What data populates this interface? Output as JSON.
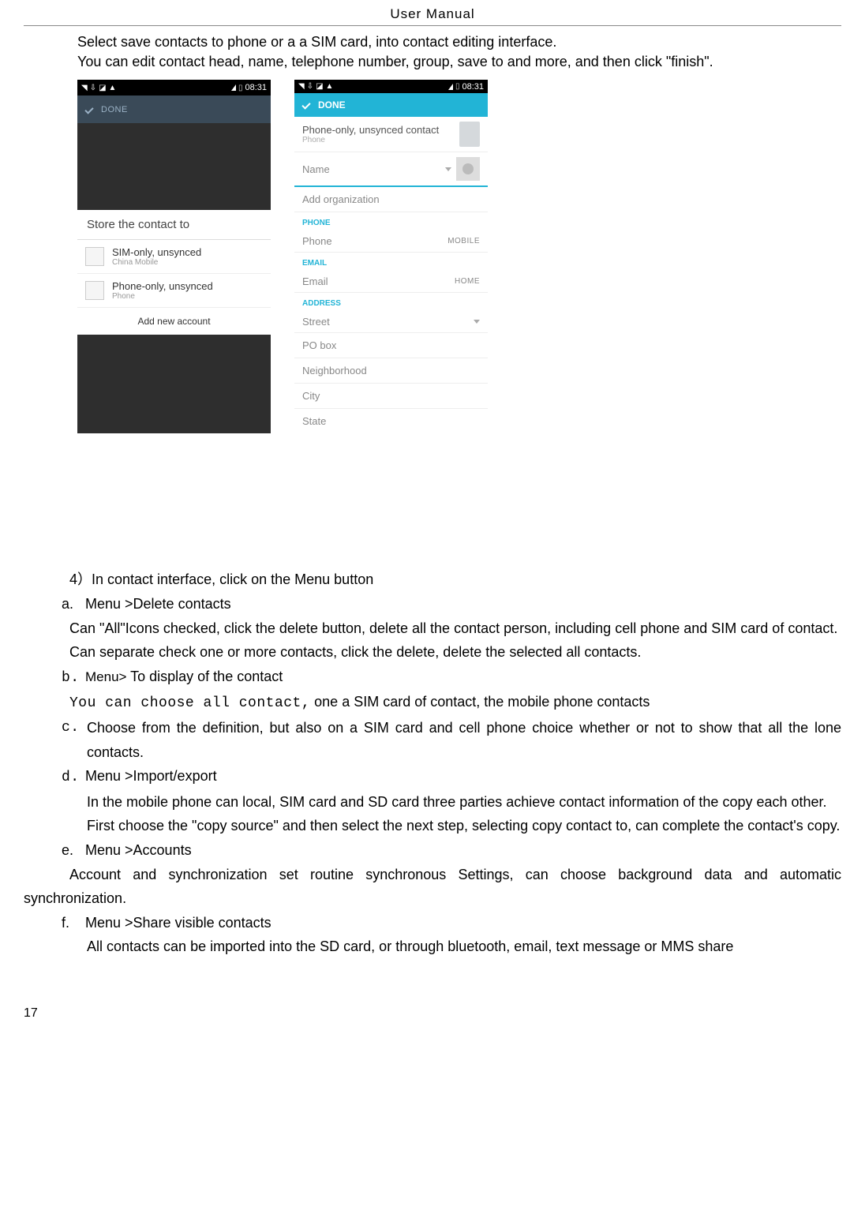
{
  "header": "User    Manual",
  "intro": {
    "line1": "Select save contacts to phone or a a SIM card, into contact editing interface.",
    "line2": "You can edit contact head, name, telephone number, group, save to and more, and then click \"finish\"."
  },
  "statusbar": {
    "time": "08:31"
  },
  "left_phone": {
    "done": "DONE",
    "dialog_title": "Store the contact to",
    "opt1_main": "SIM-only, unsynced",
    "opt1_sub": "China Mobile",
    "opt2_main": "Phone-only, unsynced",
    "opt2_sub": "Phone",
    "add_account": "Add new account"
  },
  "right_phone": {
    "done": "DONE",
    "acct_main": "Phone-only, unsynced contact",
    "acct_sub": "Phone",
    "name_ph": "Name",
    "add_org": "Add organization",
    "heading_phone": "PHONE",
    "phone_ph": "Phone",
    "phone_type": "MOBILE",
    "heading_email": "EMAIL",
    "email_ph": "Email",
    "email_type": "HOME",
    "heading_address": "ADDRESS",
    "street_ph": "Street",
    "pobox_ph": "PO box",
    "neigh_ph": "Neighborhood",
    "city_ph": "City",
    "state_ph": "State"
  },
  "section4": {
    "title": "4）In contact    interface, click on the Menu button",
    "a_label": "a.",
    "a_title": "Menu >Delete contacts",
    "a_body1": "Can \"All\"Icons checked, click the delete button, delete all the contact person, including cell phone and SIM card of contact.",
    "a_body2": "Can separate check one or more contacts, click the delete, delete the selected all contacts.",
    "b_label": "b.",
    "b_title_pre": "Menu>",
    "b_title_post": " To display of the contact",
    "b_body1_pre": "You can choose all contact,",
    "b_body1_post": " one a SIM card of contact, the mobile phone contacts",
    "c_label": "c.",
    "c_body": "Choose from the definition, but also on a SIM card and cell phone choice whether or not to show that all the lone contacts.",
    "d_label": "d.",
    "d_title": "Menu >Import/export",
    "d_body1": "In the mobile phone can local, SIM card and SD card three parties achieve contact information of the copy each other.",
    "d_body2": "First choose the \"copy source\" and then select the next step, selecting copy contact to, can complete the contact's copy.",
    "e_label": "e.",
    "e_title": "Menu >Accounts",
    "e_body": "Account and synchronization set routine synchronous Settings, can choose background data and automatic synchronization.",
    "f_label": "f.",
    "f_title": "Menu >Share visible contacts",
    "f_body": "All contacts can be imported into the SD card, or through bluetooth, email, text message or MMS share"
  },
  "page_number": "17"
}
